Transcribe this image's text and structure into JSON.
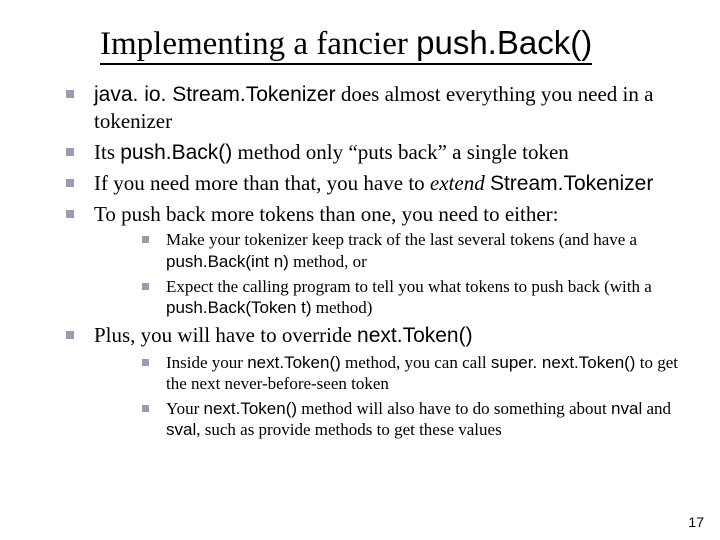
{
  "title": {
    "plain_prefix": "Implementing a fancier ",
    "code_suffix": "push.Back()"
  },
  "b1": {
    "a": "java. io. Stream.Tokenizer",
    "b": " does almost everything you need in a tokenizer"
  },
  "b2": {
    "a": "Its ",
    "b": "push.Back()",
    "c": " method only “puts back” a single token"
  },
  "b3": {
    "a": "If you need more than that, you have to ",
    "b": "extend",
    "c": " ",
    "d": "Stream.Tokenizer"
  },
  "b4": "To push back more tokens than one, you need to either:",
  "b4s1": {
    "a": "Make your tokenizer keep track of the last several tokens (and have a ",
    "b": "push.Back(int n)",
    "c": " method, or"
  },
  "b4s2": {
    "a": "Expect the calling program to tell you what tokens to push back (with a ",
    "b": "push.Back(Token t)",
    "c": " method)"
  },
  "b5": {
    "a": "Plus, you will have to override ",
    "b": "next.Token()"
  },
  "b5s1": {
    "a": "Inside your ",
    "b": "next.Token()",
    "c": " method, you can call ",
    "d": "super. next.Token()",
    "e": " to get the next never-before-seen token"
  },
  "b5s2": {
    "a": "Your ",
    "b": "next.Token()",
    "c": " method will also have to do something about ",
    "d": "nval",
    "e": " and ",
    "f": "sval",
    "g": ", such as provide methods to get these values"
  },
  "page_number": "17"
}
